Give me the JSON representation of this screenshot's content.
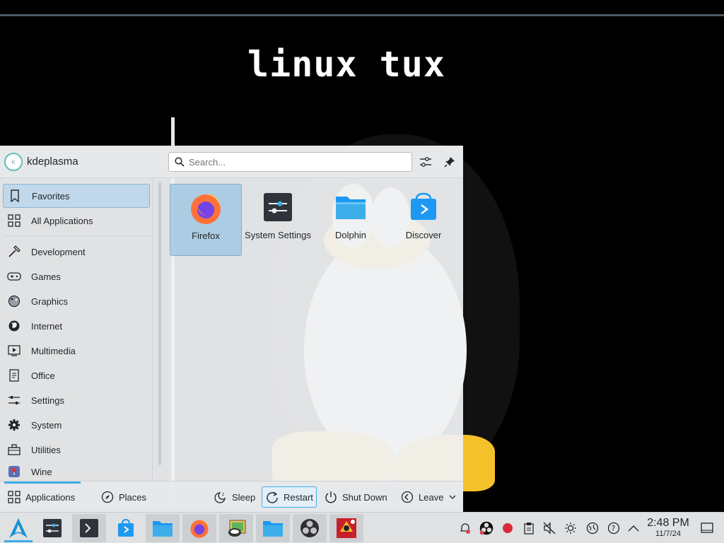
{
  "wallpaper": {
    "title": "linux tux"
  },
  "launcher": {
    "username": "kdeplasma",
    "avatar_text": "K",
    "search": {
      "placeholder": "Search...",
      "value": ""
    },
    "sidebar": {
      "items": [
        {
          "label": "Favorites",
          "icon": "bookmark-icon",
          "active": true
        },
        {
          "label": "All Applications",
          "icon": "grid-icon",
          "active": false
        },
        {
          "label": "Development",
          "icon": "hammer-icon",
          "active": false
        },
        {
          "label": "Games",
          "icon": "gamepad-icon",
          "active": false
        },
        {
          "label": "Graphics",
          "icon": "palette-icon",
          "active": false
        },
        {
          "label": "Internet",
          "icon": "globe-icon",
          "active": false
        },
        {
          "label": "Multimedia",
          "icon": "media-icon",
          "active": false
        },
        {
          "label": "Office",
          "icon": "document-icon",
          "active": false
        },
        {
          "label": "Settings",
          "icon": "sliders-icon",
          "active": false
        },
        {
          "label": "System",
          "icon": "gear-icon",
          "active": false
        },
        {
          "label": "Utilities",
          "icon": "toolbox-icon",
          "active": false
        },
        {
          "label": "Wine",
          "icon": "wine-icon",
          "active": false
        }
      ]
    },
    "favorites": [
      {
        "label": "Firefox",
        "icon": "firefox-icon",
        "selected": true
      },
      {
        "label": "System Settings",
        "icon": "system-settings-icon",
        "selected": false
      },
      {
        "label": "Dolphin",
        "icon": "folder-icon",
        "selected": false
      },
      {
        "label": "Discover",
        "icon": "discover-icon",
        "selected": false
      }
    ],
    "footer": {
      "applications": "Applications",
      "places": "Places",
      "sleep": "Sleep",
      "restart": "Restart",
      "shutdown": "Shut Down",
      "leave": "Leave"
    }
  },
  "taskbar": {
    "items": [
      "app-launcher-icon",
      "system-settings-icon",
      "terminal-icon",
      "discover-icon",
      "file-manager-icon",
      "firefox-icon",
      "image-viewer-icon",
      "folder-icon",
      "obs-icon",
      "game-icon"
    ],
    "tray": [
      "notifications-icon",
      "obs-tray-icon",
      "record-icon",
      "clipboard-icon",
      "volume-muted-icon",
      "brightness-icon",
      "network-icon",
      "help-icon",
      "expand-tray-icon"
    ],
    "clock": {
      "time": "2:48 PM",
      "date": "11/7/24"
    },
    "show_desktop": "show-desktop-icon"
  },
  "colors": {
    "accent": "#3daee9",
    "selection": "#c1d8ea",
    "panel": "#dfe1e3"
  }
}
